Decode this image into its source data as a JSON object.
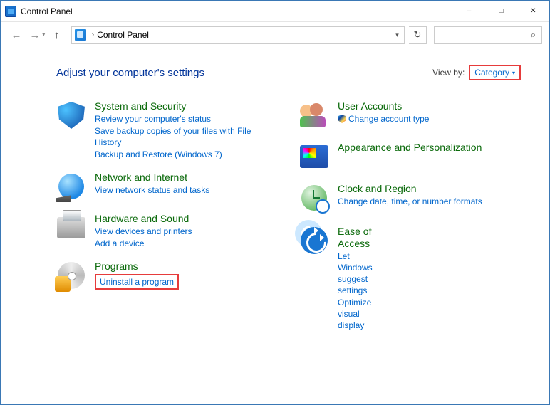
{
  "window": {
    "title": "Control Panel"
  },
  "breadcrumb": {
    "root": "Control Panel"
  },
  "heading": "Adjust your computer's settings",
  "viewby": {
    "label": "View by:",
    "value": "Category"
  },
  "left": {
    "sys": {
      "title": "System and Security",
      "l1": "Review your computer's status",
      "l2": "Save backup copies of your files with File History",
      "l3": "Backup and Restore (Windows 7)"
    },
    "net": {
      "title": "Network and Internet",
      "l1": "View network status and tasks"
    },
    "hw": {
      "title": "Hardware and Sound",
      "l1": "View devices and printers",
      "l2": "Add a device"
    },
    "prog": {
      "title": "Programs",
      "l1": "Uninstall a program"
    }
  },
  "right": {
    "user": {
      "title": "User Accounts",
      "l1": "Change account type"
    },
    "appear": {
      "title": "Appearance and Personalization"
    },
    "clock": {
      "title": "Clock and Region",
      "l1": "Change date, time, or number formats"
    },
    "ease": {
      "title": "Ease of Access",
      "l1": "Let Windows suggest settings",
      "l2": "Optimize visual display"
    }
  }
}
